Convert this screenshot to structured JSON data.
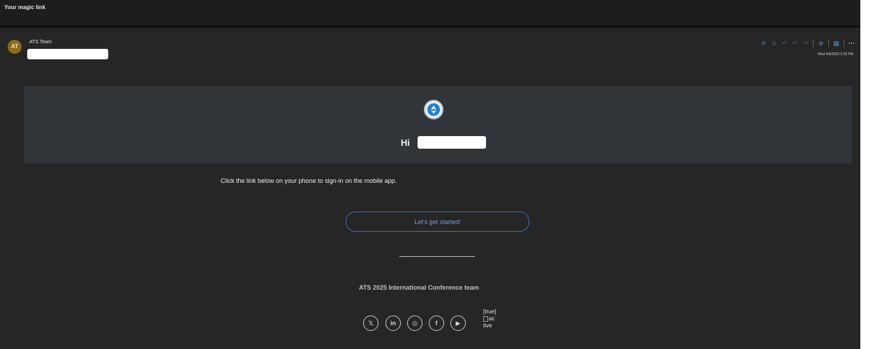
{
  "email": {
    "subject": "Your magic link",
    "sender_initials": "AT",
    "sender_name": "ATS Team",
    "date": "Wed 4/9/2025 2:25 PM"
  },
  "toolbar": {
    "icons": [
      "summary-icon",
      "emoji-reaction-icon",
      "reply-icon",
      "reply-all-icon",
      "forward-icon",
      "apps-icon",
      "view-icon",
      "more-icon"
    ],
    "more_label": "···"
  },
  "body": {
    "greeting": "Hi",
    "instruction": "Click the link below on your phone to sign-in on the mobile app.",
    "cta_label": "Let's get started!",
    "team": "ATS 2025 International Conference team"
  },
  "social": {
    "x_label": "𝕏",
    "linkedin_label": "in",
    "instagram_label": "◎",
    "facebook_label": "f",
    "youtube_label": "▶"
  },
  "broken_image_alt": [
    "[true]",
    "ac",
    "tive"
  ],
  "colors": {
    "background": "#262626",
    "banner": "#31353a",
    "accent": "#3d6fb4",
    "avatar": "#8d6a1c"
  }
}
